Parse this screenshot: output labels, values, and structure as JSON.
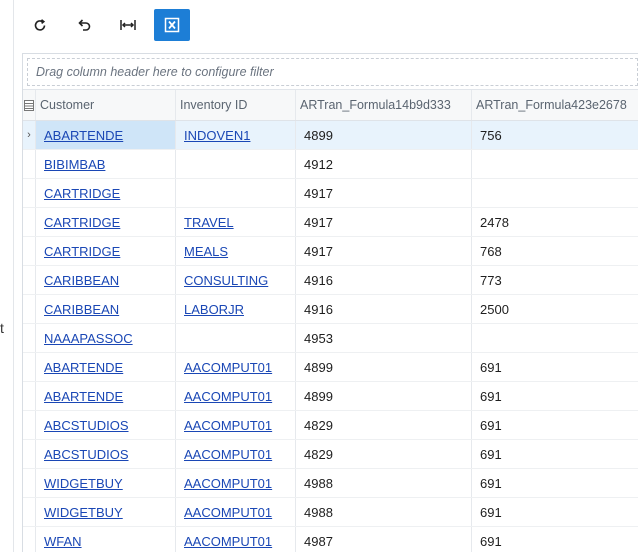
{
  "left_fragment": "t",
  "filter_placeholder": "Drag column header here to configure filter",
  "columns": {
    "customer": "Customer",
    "inventory": "Inventory ID",
    "formula1": "ARTran_Formula14b9d333",
    "formula2": "ARTran_Formula423e2678"
  },
  "rows": [
    {
      "customer": "ABARTENDE",
      "inventory": "INDOVEN1",
      "f1": "4899",
      "f2": "756"
    },
    {
      "customer": "BIBIMBAB",
      "inventory": "",
      "f1": "4912",
      "f2": ""
    },
    {
      "customer": "CARTRIDGE",
      "inventory": "",
      "f1": "4917",
      "f2": ""
    },
    {
      "customer": "CARTRIDGE",
      "inventory": "TRAVEL",
      "f1": "4917",
      "f2": "2478"
    },
    {
      "customer": "CARTRIDGE",
      "inventory": "MEALS",
      "f1": "4917",
      "f2": "768"
    },
    {
      "customer": "CARIBBEAN",
      "inventory": "CONSULTING",
      "f1": "4916",
      "f2": "773"
    },
    {
      "customer": "CARIBBEAN",
      "inventory": "LABORJR",
      "f1": "4916",
      "f2": "2500"
    },
    {
      "customer": "NAAAPASSOC",
      "inventory": "",
      "f1": "4953",
      "f2": ""
    },
    {
      "customer": "ABARTENDE",
      "inventory": "AACOMPUT01",
      "f1": "4899",
      "f2": "691"
    },
    {
      "customer": "ABARTENDE",
      "inventory": "AACOMPUT01",
      "f1": "4899",
      "f2": "691"
    },
    {
      "customer": "ABCSTUDIOS",
      "inventory": "AACOMPUT01",
      "f1": "4829",
      "f2": "691"
    },
    {
      "customer": "ABCSTUDIOS",
      "inventory": "AACOMPUT01",
      "f1": "4829",
      "f2": "691"
    },
    {
      "customer": "WIDGETBUY",
      "inventory": "AACOMPUT01",
      "f1": "4988",
      "f2": "691"
    },
    {
      "customer": "WIDGETBUY",
      "inventory": "AACOMPUT01",
      "f1": "4988",
      "f2": "691"
    },
    {
      "customer": "WFAN",
      "inventory": "AACOMPUT01",
      "f1": "4987",
      "f2": "691"
    }
  ],
  "toolbar_icons": [
    "refresh-icon",
    "undo-icon",
    "fit-width-icon",
    "excel-export-icon"
  ],
  "colors": {
    "accent": "#1d7ed6",
    "link": "#1a47b5",
    "selected_row": "#e8f3fc"
  }
}
